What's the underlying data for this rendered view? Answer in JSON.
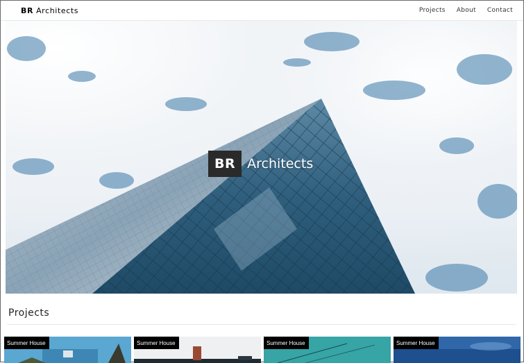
{
  "navbar": {
    "logo_bold": "BR",
    "logo_text": "Architects",
    "links": [
      {
        "label": "Projects"
      },
      {
        "label": "About"
      },
      {
        "label": "Contact"
      }
    ]
  },
  "hero": {
    "badge": "BR",
    "title": "Architects"
  },
  "projects": {
    "heading": "Projects",
    "cards": [
      {
        "label": "Summer House"
      },
      {
        "label": "Summer House"
      },
      {
        "label": "Summer House"
      },
      {
        "label": "Summer House"
      }
    ]
  },
  "colors": {
    "badge_bg": "#2a2a2a",
    "sky": "#dfe8ef",
    "glass": "#3e6f8c"
  }
}
